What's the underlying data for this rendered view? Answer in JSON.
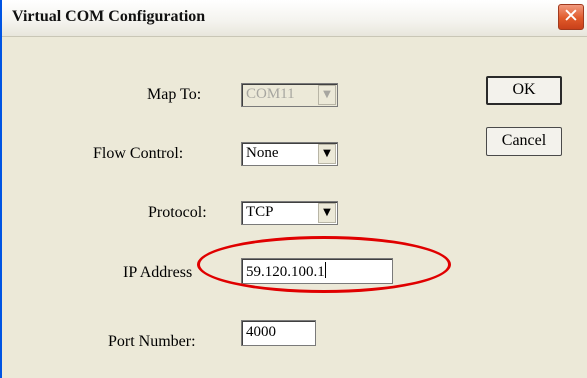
{
  "window": {
    "title": "Virtual COM Configuration",
    "close_glyph": "✕"
  },
  "form": {
    "map_to": {
      "label": "Map To:",
      "value": "COM11",
      "disabled": true
    },
    "flow_control": {
      "label": "Flow Control:",
      "value": "None"
    },
    "protocol": {
      "label": "Protocol:",
      "value": "TCP"
    },
    "ip_address": {
      "label": "IP Address",
      "value": "59.120.100.1"
    },
    "port_number": {
      "label": "Port Number:",
      "value": "4000"
    }
  },
  "buttons": {
    "ok": "OK",
    "cancel": "Cancel"
  },
  "icons": {
    "dropdown_arrow": "▼"
  },
  "colors": {
    "highlight": "#e00000",
    "close_button": "#e05a2a"
  }
}
